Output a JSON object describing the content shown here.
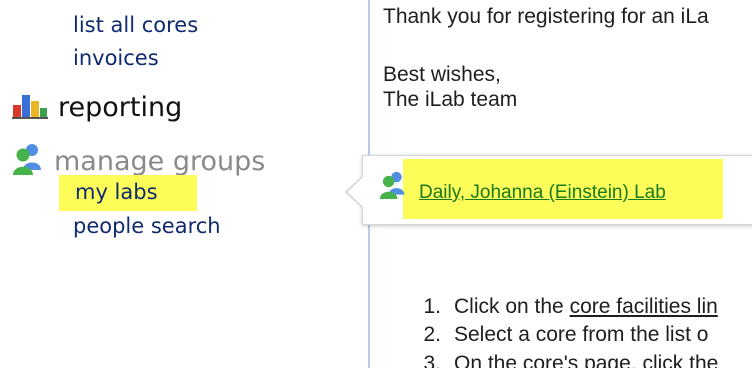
{
  "sidebar": {
    "links_top": [
      {
        "label": "list all cores"
      },
      {
        "label": "invoices"
      }
    ],
    "reporting": {
      "label": "reporting",
      "icon": "bar-chart-icon"
    },
    "manage_groups": {
      "label": "manage groups",
      "icon": "people-group-icon",
      "items": [
        {
          "label": "my labs",
          "highlighted": true
        },
        {
          "label": "people search",
          "highlighted": false
        }
      ]
    }
  },
  "email": {
    "intro": "Thank you for registering for an iLa",
    "closing": "Best wishes,",
    "signature": "The iLab team",
    "steps": [
      {
        "num": "1.",
        "prefix": "Click on the ",
        "link": "core facilities lin"
      },
      {
        "num": "2.",
        "prefix": "Select a core from the list o",
        "link": ""
      },
      {
        "num": "3.",
        "prefix": "On the core's page, click the",
        "link": ""
      }
    ]
  },
  "popup": {
    "lab_link": "Daily, Johanna (Einstein) Lab",
    "icon": "people-group-icon"
  },
  "colors": {
    "highlight": "#fdfd5a",
    "sidebar_link": "#0f2a6e",
    "popup_link": "#1a7a1a",
    "section_muted": "#8a8a8a"
  }
}
